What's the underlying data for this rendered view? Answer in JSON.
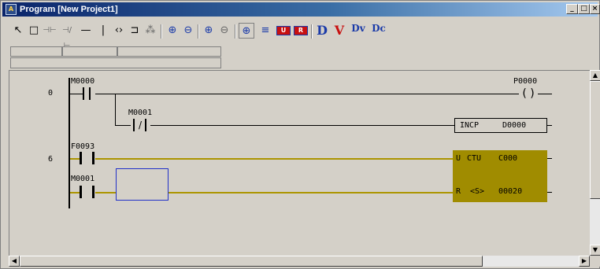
{
  "window": {
    "app_icon": "plc-program-icon",
    "app_icon_glyph": "A",
    "title": "Program  [New Project1]",
    "controls": {
      "minimize": "_",
      "maximize": "□",
      "close": "×"
    }
  },
  "toolbar": {
    "tools": [
      {
        "name": "select-pointer-icon",
        "glyph": "↖"
      },
      {
        "name": "insert-box-icon",
        "glyph": "□"
      },
      {
        "name": "no-contact-icon",
        "glyph": "⊣⊢"
      },
      {
        "name": "nc-contact-icon",
        "glyph": "⊣/⊢"
      },
      {
        "name": "horizontal-line-icon",
        "glyph": "—"
      },
      {
        "name": "vertical-line-icon",
        "glyph": "|"
      },
      {
        "name": "coil-icon",
        "glyph": "‹›"
      },
      {
        "name": "function-box-icon",
        "glyph": "⊐"
      },
      {
        "name": "multiline-icon",
        "glyph": "⁂"
      },
      {
        "name": "zoom-in-icon",
        "glyph": "⊕"
      },
      {
        "name": "zoom-out-icon",
        "glyph": "⊖"
      },
      {
        "name": "zoom-in-alt-icon",
        "glyph": "⊕"
      },
      {
        "name": "zoom-out-alt-icon",
        "glyph": "⊖"
      },
      {
        "name": "zoom-fit-icon",
        "glyph": "⊕"
      },
      {
        "name": "comment-icon",
        "glyph": "≡"
      },
      {
        "name": "upload-icon",
        "glyph": "U"
      },
      {
        "name": "download-icon",
        "glyph": "R"
      },
      {
        "name": "device-d-icon",
        "glyph": "D"
      },
      {
        "name": "device-v-icon",
        "glyph": "V"
      },
      {
        "name": "device-dv-icon",
        "glyph": "Dv"
      },
      {
        "name": "device-dc-icon",
        "glyph": "Dc"
      }
    ]
  },
  "ladder": {
    "steps": [
      {
        "number": "0"
      },
      {
        "number": "6"
      }
    ],
    "contacts": [
      {
        "id": "M0000",
        "label": "M0000",
        "type": "no",
        "active": false
      },
      {
        "id": "M0001a",
        "label": "M0001",
        "type": "nc",
        "active": false
      },
      {
        "id": "F0093",
        "label": "F0093",
        "type": "no",
        "active": true
      },
      {
        "id": "M0001b",
        "label": "M0001",
        "type": "no",
        "active": true
      }
    ],
    "coil": {
      "label": "P0000",
      "glyph": "( )"
    },
    "incp": {
      "op": "INCP",
      "operand": "D0000"
    },
    "ctu": {
      "up_pin": "U",
      "op": "CTU",
      "counter": "C000",
      "reset_pin": "R",
      "setting": "<S>",
      "value": "00020"
    }
  },
  "colors": {
    "energized": "#ac9500",
    "function_block": "#a08c00",
    "cursor": "#2030c8",
    "title_start": "#0a246a"
  }
}
